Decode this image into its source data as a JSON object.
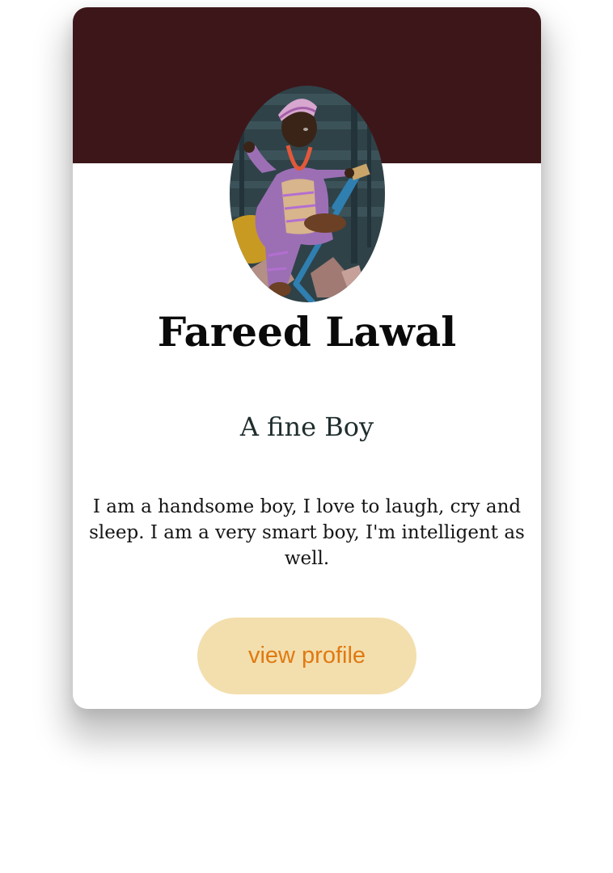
{
  "card": {
    "banner_color": "#3d1619",
    "name": "Fareed Lawal",
    "tagline": "A fine Boy",
    "bio": "I am a handsome boy, I love to laugh, cry and sleep. I am a very smart boy, I'm intelligent as well.",
    "button": {
      "label": "view profile",
      "background": "#f3dfae",
      "text_color": "#e07a12"
    },
    "avatar_icon": "profile-photo"
  }
}
